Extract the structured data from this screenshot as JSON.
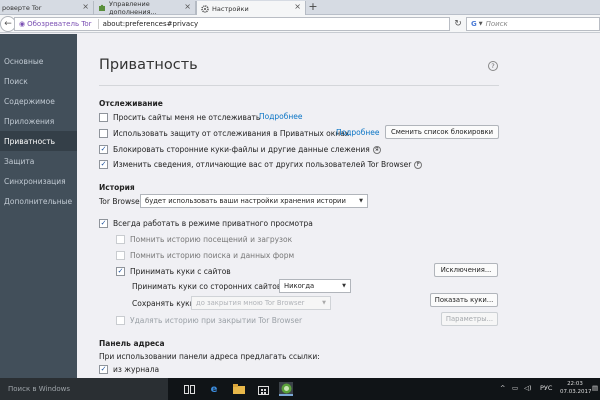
{
  "tabs": [
    {
      "title": "роверте Tor",
      "active": false
    },
    {
      "title": "Управление дополнения...",
      "active": false
    },
    {
      "title": "Настройки",
      "active": true
    }
  ],
  "navbar": {
    "identity_label": "Обозреватель Tor",
    "url": "about:preferences#privacy",
    "search_placeholder": "Поиск"
  },
  "sidebar": {
    "items": [
      {
        "label": "Основные",
        "active": false
      },
      {
        "label": "Поиск",
        "active": false
      },
      {
        "label": "Содержимое",
        "active": false
      },
      {
        "label": "Приложения",
        "active": false
      },
      {
        "label": "Приватность",
        "active": true
      },
      {
        "label": "Защита",
        "active": false
      },
      {
        "label": "Синхронизация",
        "active": false
      },
      {
        "label": "Дополнительные",
        "active": false
      }
    ]
  },
  "page": {
    "title": "Приватность",
    "help": "?"
  },
  "tracking": {
    "heading": "Отслеживание",
    "dnt_label": "Просить сайты меня не отслеживать",
    "dnt_checked": false,
    "dnt_more": "Подробнее",
    "protect_label": "Использовать защиту от отслеживания в Приватных окнах",
    "protect_checked": false,
    "protect_more": "Подробнее",
    "change_blocklist": "Сменить список блокировки",
    "block_cookies_label": "Блокировать сторонние куки-файлы и другие данные слежения",
    "block_cookies_key": "Я",
    "block_cookies_checked": true,
    "change_info_label": "Изменить сведения, отличающие вас от других пользователей Tor Browser",
    "change_info_key": "F",
    "change_info_checked": true
  },
  "history": {
    "heading": "История",
    "browser_prefix": "Tor Browser",
    "mode_select": "будет использовать ваши настройки хранения истории",
    "always_private_label": "Всегда работать в режиме приватного просмотра",
    "always_private_checked": true,
    "remember_visits": "Помнить историю посещений и загрузок",
    "remember_search": "Помнить историю поиска и данных форм",
    "accept_cookies_label": "Принимать куки с сайтов",
    "accept_cookies_checked": true,
    "exceptions_button": "Исключения...",
    "third_party_label": "Принимать куки со сторонних сайтов:",
    "third_party_value": "Никогда",
    "keep_label": "Сохранять куки:",
    "keep_value": "до закрытия мною Tor Browser",
    "show_cookies_button": "Показать куки...",
    "clear_on_close_label": "Удалять историю при закрытии Tor Browser",
    "settings_button": "Параметры..."
  },
  "addressbar": {
    "heading": "Панель адреса",
    "suggest_label": "При использовании панели адреса предлагать ссылки:",
    "history_label": "из журнала",
    "history_checked": true
  },
  "taskbar": {
    "search_placeholder": "Поиск в Windows",
    "language": "РУС",
    "time": "22:03",
    "date": "07.03.2017"
  }
}
